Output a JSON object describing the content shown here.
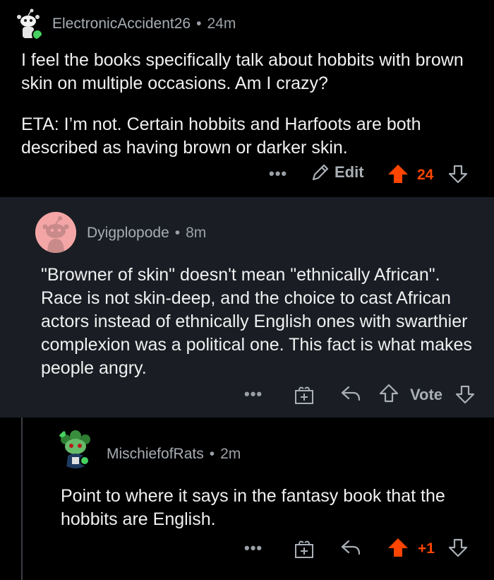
{
  "comments": [
    {
      "author": "ElectronicAccident26",
      "time": "24m",
      "paragraphs": [
        "I feel the books specifically talk about hobbits with brown skin on multiple occasions. Am I crazy?",
        "ETA: I’m not. Certain hobbits and Harfoots are both described as having brown or darker skin."
      ],
      "actions": {
        "more": "•••",
        "edit_label": "Edit",
        "score": "24"
      },
      "avatar_icon": "snoo-avatar-icon"
    },
    {
      "author": "Dyigplopode",
      "time": "8m",
      "paragraphs": [
        "\"Browner of skin\" doesn't mean \"ethnically African\". Race is not skin-deep, and the choice to cast African actors instead of ethnically English ones with swarthier complexion was a political one. This fact is what makes people angry."
      ],
      "actions": {
        "more": "•••",
        "vote_label": "Vote"
      },
      "avatar_icon": "default-snoo-avatar-icon"
    },
    {
      "author": "MischiefofRats",
      "time": "2m",
      "paragraphs": [
        "Point to where it says in the fantasy book that the hobbits are English."
      ],
      "actions": {
        "more": "•••",
        "score": "+1"
      },
      "avatar_icon": "snoo-avatar-icon"
    }
  ],
  "separator": "•",
  "colors": {
    "upvote": "#ff4500",
    "background": "#000000",
    "highlight_bg": "#1a1e24",
    "text": "#f0f0f0",
    "muted": "#9aa0a6"
  }
}
